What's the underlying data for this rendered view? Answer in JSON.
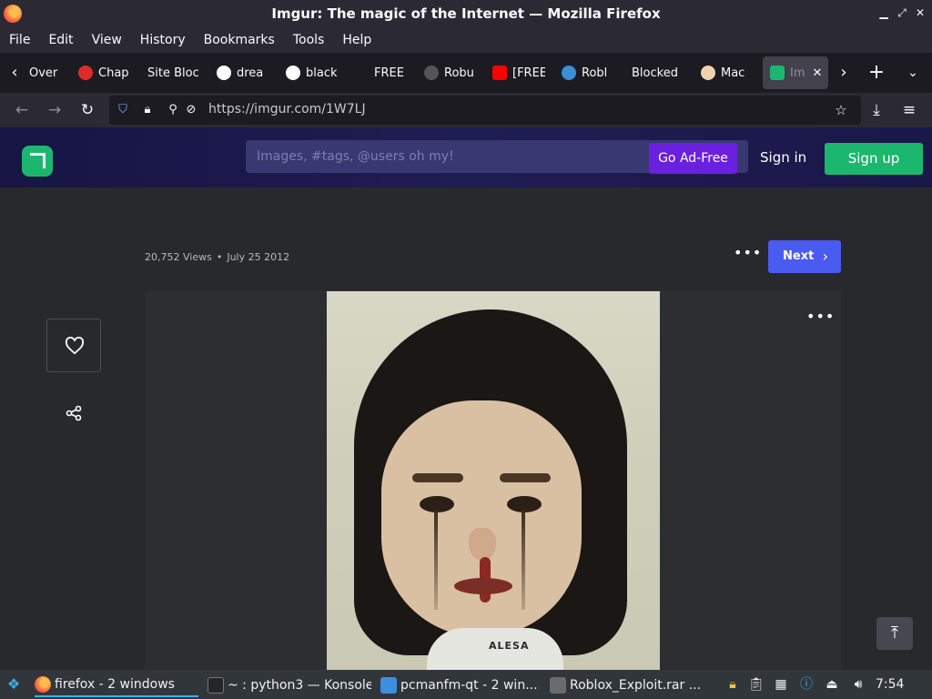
{
  "window": {
    "title": "Imgur: The magic of the Internet — Mozilla Firefox"
  },
  "menu": [
    "File",
    "Edit",
    "View",
    "History",
    "Bookmarks",
    "Tools",
    "Help"
  ],
  "tabs": [
    {
      "label": "Over",
      "favicon_color": ""
    },
    {
      "label": "Chap",
      "favicon_color": "#e02b2b"
    },
    {
      "label": "Site Bloc",
      "favicon_color": ""
    },
    {
      "label": "drea",
      "favicon_color": "#ffffff"
    },
    {
      "label": "black",
      "favicon_color": "#ffffff"
    },
    {
      "label": "FREE",
      "favicon_color": ""
    },
    {
      "label": "Robu",
      "favicon_color": "#555555"
    },
    {
      "label": "[FREE",
      "favicon_color": "#ff0000"
    },
    {
      "label": "Robl",
      "favicon_color": "#3a8fd6"
    },
    {
      "label": "Blocked",
      "favicon_color": ""
    },
    {
      "label": "Mac",
      "favicon_color": "#f1d2b0"
    },
    {
      "label": "Im",
      "favicon_color": "#1bb76e",
      "active": true
    }
  ],
  "nav": {
    "url": "https://imgur.com/1W7LJ"
  },
  "imgur": {
    "search_placeholder": "Images, #tags, @users oh my!",
    "adfree_label": "Go Ad-Free",
    "signin_label": "Sign in",
    "signup_label": "Sign up"
  },
  "post": {
    "views": "20,752 Views",
    "date": "July 25 2012",
    "next_label": "Next",
    "image_caption_text": "ALESA"
  },
  "taskbar": {
    "tasks": [
      {
        "label": "firefox - 2 windows",
        "active": true
      },
      {
        "label": "~ : python3 — Konsole",
        "active": false
      },
      {
        "label": "pcmanfm-qt - 2 win...",
        "active": false
      },
      {
        "label": "Roblox_Exploit.rar ...",
        "active": false
      }
    ],
    "clock": "7:54"
  },
  "colors": {
    "imgur_green": "#1bb76e",
    "imgur_purple": "#6b20e0",
    "next_blue": "#4a5bf0"
  }
}
